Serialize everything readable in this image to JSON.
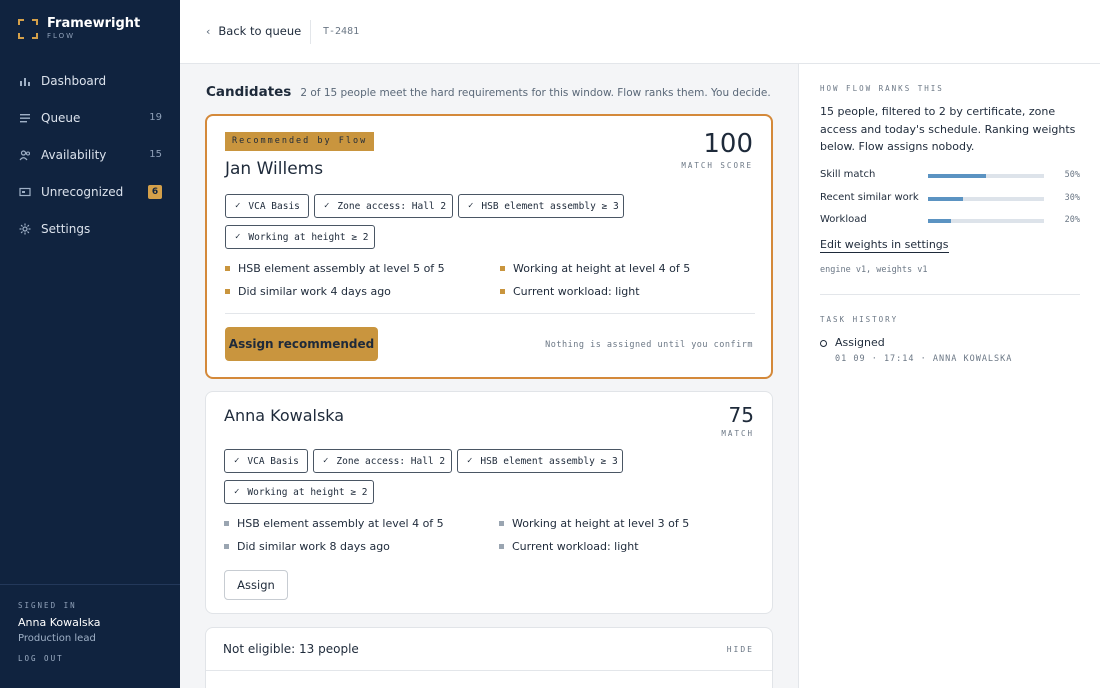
{
  "sidebar": {
    "brand": {
      "name": "Framewright",
      "sub": "FLOW"
    },
    "items": [
      {
        "label": "Dashboard",
        "icon": "bar-chart-icon",
        "count": ""
      },
      {
        "label": "Queue",
        "icon": "list-icon",
        "count": "19"
      },
      {
        "label": "Availability",
        "icon": "people-icon",
        "count": "15"
      },
      {
        "label": "Unrecognized",
        "icon": "id-card-icon",
        "count": "6"
      },
      {
        "label": "Settings",
        "icon": "gear-icon",
        "count": ""
      }
    ],
    "footer": {
      "signed_in_label": "SIGNED IN",
      "user_name": "Anna Kowalska",
      "user_role": "Production lead",
      "logout_label": "LOG OUT"
    }
  },
  "topbar": {
    "back_label": "Back to queue",
    "ticket_id": "T-2481"
  },
  "main": {
    "title": "Candidates",
    "subtitle": "2 of 15 people meet the hard requirements for this window. Flow ranks them. You decide.",
    "candidates": [
      {
        "tag": "Recommended by Flow",
        "name": "Jan Willems",
        "score": "100",
        "score_label": "MATCH SCORE",
        "chips": [
          "VCA Basis",
          "Zone access: Hall 2",
          "HSB element assembly ≥ 3",
          "Working at height ≥ 2"
        ],
        "facts": [
          "HSB element assembly at level 5 of 5",
          "Working at height at level 4 of 5",
          "Did similar work 4 days ago",
          "Current workload: light"
        ],
        "action": "Assign recommended",
        "note": "Nothing is assigned until you confirm"
      },
      {
        "name": "Anna Kowalska",
        "score": "75",
        "score_label": "MATCH",
        "chips": [
          "VCA Basis",
          "Zone access: Hall 2",
          "HSB element assembly ≥ 3",
          "Working at height ≥ 2"
        ],
        "facts": [
          "HSB element assembly at level 4 of 5",
          "Working at height at level 3 of 5",
          "Did similar work 8 days ago",
          "Current workload: light"
        ],
        "action": "Assign"
      }
    ],
    "not_eligible": {
      "title": "Not eligible: 13 people",
      "hide_label": "HIDE"
    }
  },
  "panel": {
    "ranking_label": "HOW FLOW RANKS THIS",
    "ranking_desc": "15 people, filtered to 2 by certificate, zone access and today's schedule. Ranking weights below. Flow assigns nobody.",
    "weights": [
      {
        "label": "Skill match",
        "value": 0.5,
        "pct": "50%"
      },
      {
        "label": "Recent similar work",
        "value": 0.3,
        "pct": "30%"
      },
      {
        "label": "Workload",
        "value": 0.2,
        "pct": "20%"
      }
    ],
    "edit_link": "Edit weights in settings",
    "engine": "engine v1, weights v1",
    "history_label": "TASK HISTORY",
    "history": [
      {
        "title": "Assigned",
        "meta": "01 09 · 17:14 · ANNA KOWALSKA"
      }
    ]
  },
  "colors": {
    "sidebar_bg": "#10233f",
    "accent_gold": "#c9953e",
    "recommended_border": "#d4893a",
    "weight_bar": "#5b93c2"
  }
}
